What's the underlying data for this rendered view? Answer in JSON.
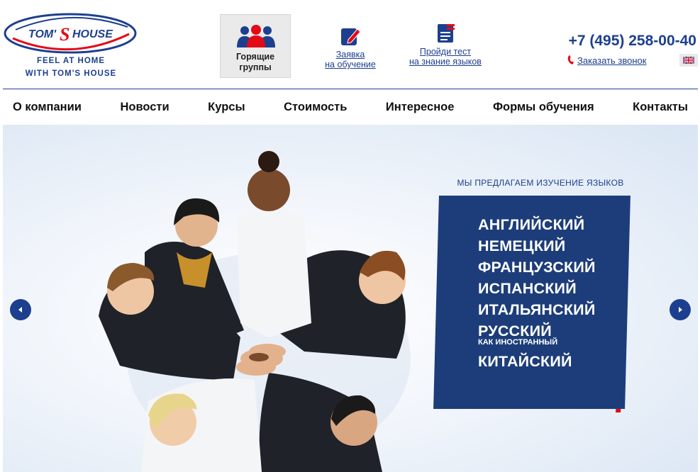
{
  "brand": {
    "logo_text": "TOM'S HOUSE",
    "tagline_line1": "FEEL AT HOME",
    "tagline_line2": "WITH TOM'S HOUSE",
    "primary_color": "#1d3f8f",
    "accent_color": "#e30a17"
  },
  "header": {
    "hot_groups_label": "Горящие группы",
    "hot_groups_icon": "group-people-icon",
    "apply_label_1": "Заявка",
    "apply_label_2": "на обучение",
    "apply_icon": "pen-form-icon",
    "test_label_1": "Пройди тест",
    "test_label_2": "на знание языков",
    "test_icon": "test-document-icon",
    "phone": "+7 (495) 258-00-40",
    "callback_label": "Заказать звонок",
    "callback_icon": "phone-handset-icon",
    "language_icon": "uk-flag-icon"
  },
  "nav": {
    "items": [
      "О компании",
      "Новости",
      "Курсы",
      "Стоимость",
      "Интересное",
      "Формы обучения",
      "Контакты"
    ]
  },
  "banner": {
    "offer_title": "МЫ ПРЕДЛАГАЕМ ИЗУЧЕНИЕ ЯЗЫКОВ",
    "languages": [
      "АНГЛИЙСКИЙ",
      "НЕМЕЦКИЙ",
      "ФРАНЦУЗСКИЙ",
      "ИСПАНСКИЙ",
      "ИТАЛЬЯНСКИЙ",
      "РУССКИЙ"
    ],
    "russian_note": "КАК ИНОСТРАННЫЙ",
    "last_language": "КИТАЙСКИЙ",
    "prev_icon": "chevron-left-icon",
    "next_icon": "chevron-right-icon",
    "box_color": "#1d3d7a"
  }
}
